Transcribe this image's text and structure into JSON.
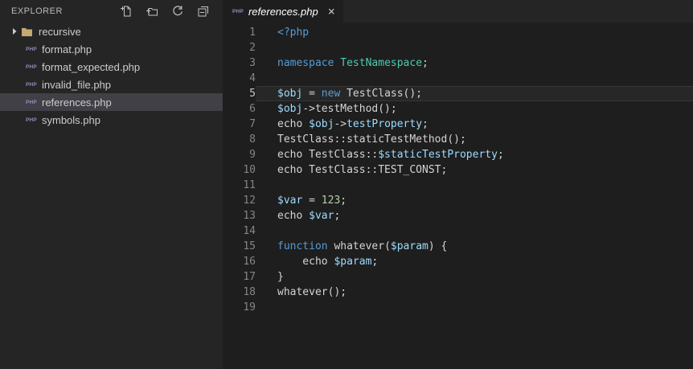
{
  "explorer": {
    "title": "EXPLORER",
    "selected_file": "references.php",
    "files": [
      {
        "label": "recursive",
        "type": "folder"
      },
      {
        "label": "format.php",
        "type": "php"
      },
      {
        "label": "format_expected.php",
        "type": "php"
      },
      {
        "label": "invalid_file.php",
        "type": "php"
      },
      {
        "label": "references.php",
        "type": "php"
      },
      {
        "label": "symbols.php",
        "type": "php"
      }
    ]
  },
  "php_icon_label": "PHP",
  "tab": {
    "label": "references.php",
    "close_glyph": "×"
  },
  "editor": {
    "current_line": 5,
    "colors": {
      "k": "#569CD6",
      "t": "#4EC9B0",
      "v": "#9CDCFE",
      "n": "#B5CEA8",
      "d": "#D4D4D4"
    },
    "lines": [
      [
        {
          "c": "k",
          "t": "<?php"
        }
      ],
      [],
      [
        {
          "c": "k",
          "t": "namespace"
        },
        {
          "c": "d",
          "t": " "
        },
        {
          "c": "t",
          "t": "TestNamespace"
        },
        {
          "c": "d",
          "t": ";"
        }
      ],
      [],
      [
        {
          "c": "v",
          "t": "$obj"
        },
        {
          "c": "d",
          "t": " = "
        },
        {
          "c": "k",
          "t": "new"
        },
        {
          "c": "d",
          "t": " TestClass();"
        }
      ],
      [
        {
          "c": "v",
          "t": "$obj"
        },
        {
          "c": "d",
          "t": "->testMethod();"
        }
      ],
      [
        {
          "c": "d",
          "t": "echo "
        },
        {
          "c": "v",
          "t": "$obj"
        },
        {
          "c": "d",
          "t": "->"
        },
        {
          "c": "v",
          "t": "testProperty"
        },
        {
          "c": "d",
          "t": ";"
        }
      ],
      [
        {
          "c": "d",
          "t": "TestClass::staticTestMethod();"
        }
      ],
      [
        {
          "c": "d",
          "t": "echo TestClass::"
        },
        {
          "c": "v",
          "t": "$staticTestProperty"
        },
        {
          "c": "d",
          "t": ";"
        }
      ],
      [
        {
          "c": "d",
          "t": "echo TestClass::TEST_CONST;"
        }
      ],
      [],
      [
        {
          "c": "v",
          "t": "$var"
        },
        {
          "c": "d",
          "t": " = "
        },
        {
          "c": "n",
          "t": "123"
        },
        {
          "c": "d",
          "t": ";"
        }
      ],
      [
        {
          "c": "d",
          "t": "echo "
        },
        {
          "c": "v",
          "t": "$var"
        },
        {
          "c": "d",
          "t": ";"
        }
      ],
      [],
      [
        {
          "c": "k",
          "t": "function"
        },
        {
          "c": "d",
          "t": " whatever("
        },
        {
          "c": "v",
          "t": "$param"
        },
        {
          "c": "d",
          "t": ") {"
        }
      ],
      [
        {
          "c": "d",
          "t": "    echo "
        },
        {
          "c": "v",
          "t": "$param"
        },
        {
          "c": "d",
          "t": ";"
        }
      ],
      [
        {
          "c": "d",
          "t": "}"
        }
      ],
      [
        {
          "c": "d",
          "t": "whatever();"
        }
      ],
      []
    ]
  }
}
